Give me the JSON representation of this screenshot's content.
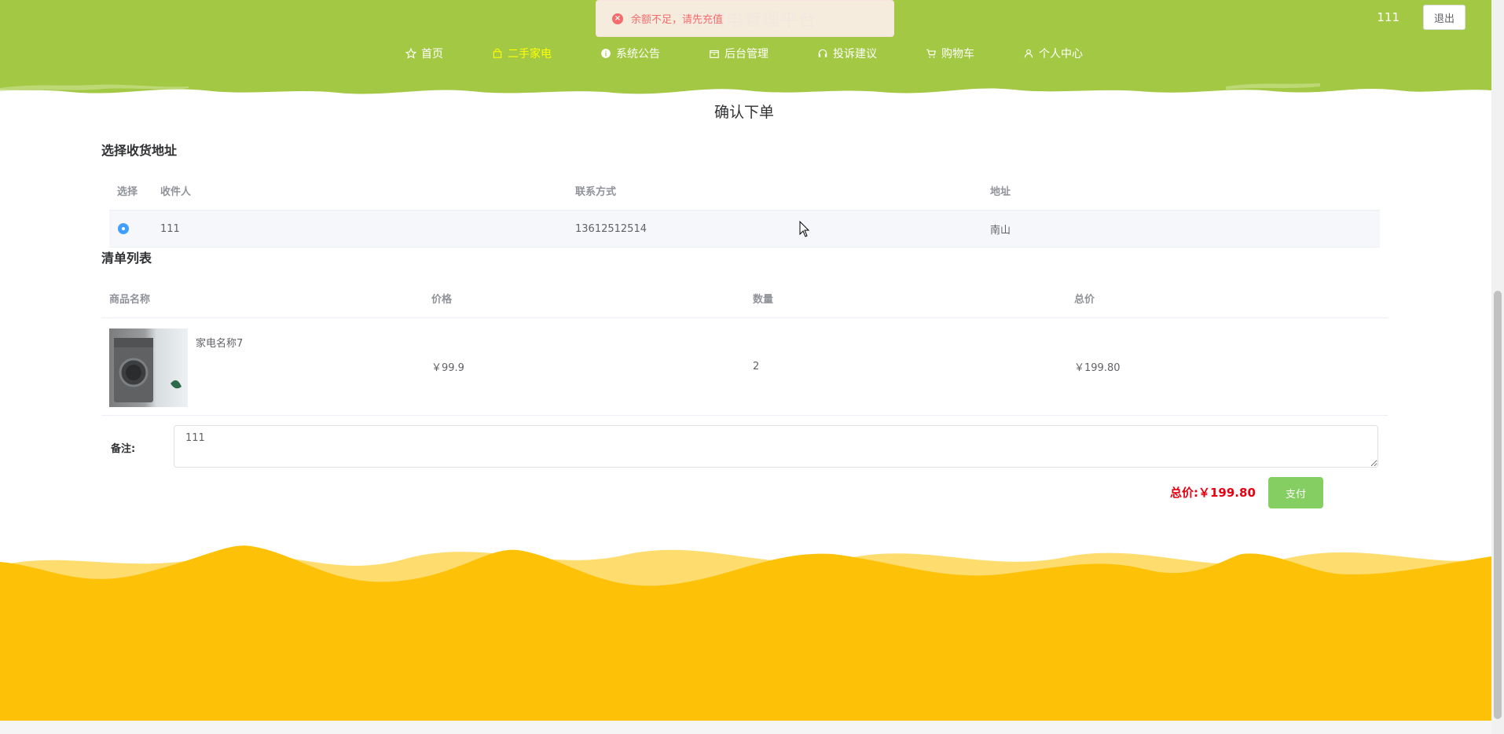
{
  "header": {
    "site_title": "二手家电管理平台",
    "nav": [
      {
        "label": "首页",
        "icon": "star-icon",
        "active": false
      },
      {
        "label": "二手家电",
        "icon": "bag-icon",
        "active": true
      },
      {
        "label": "系统公告",
        "icon": "info-circle-icon",
        "active": false
      },
      {
        "label": "后台管理",
        "icon": "box-icon",
        "active": false
      },
      {
        "label": "投诉建议",
        "icon": "headset-icon",
        "active": false
      },
      {
        "label": "购物车",
        "icon": "cart-icon",
        "active": false
      },
      {
        "label": "个人中心",
        "icon": "user-icon",
        "active": false
      }
    ],
    "username": "111",
    "logout_label": "退出"
  },
  "toast": {
    "message": "余额不足，请先充值",
    "type": "error"
  },
  "page_heading": "确认下单",
  "address_section": {
    "title": "选择收货地址",
    "columns": [
      "选择",
      "收件人",
      "联系方式",
      "地址"
    ],
    "rows": [
      {
        "selected": true,
        "recipient": "111",
        "phone": "13612512514",
        "address": "南山"
      }
    ]
  },
  "list_section": {
    "title": "清单列表",
    "columns": [
      "商品名称",
      "价格",
      "数量",
      "总价"
    ],
    "items": [
      {
        "name": "家电名称7",
        "price": "￥99.9",
        "quantity": "2",
        "subtotal": "￥199.80"
      }
    ]
  },
  "remark": {
    "label": "备注:",
    "value": "111"
  },
  "total": {
    "label": "总价:",
    "amount": "￥199.80"
  },
  "pay_label": "支付",
  "colors": {
    "header_green": "#a3c843",
    "footer_yellow": "#fdc107",
    "footer_light": "#fedd6e",
    "pay_button": "#85ce61",
    "total_red": "#e60012"
  }
}
